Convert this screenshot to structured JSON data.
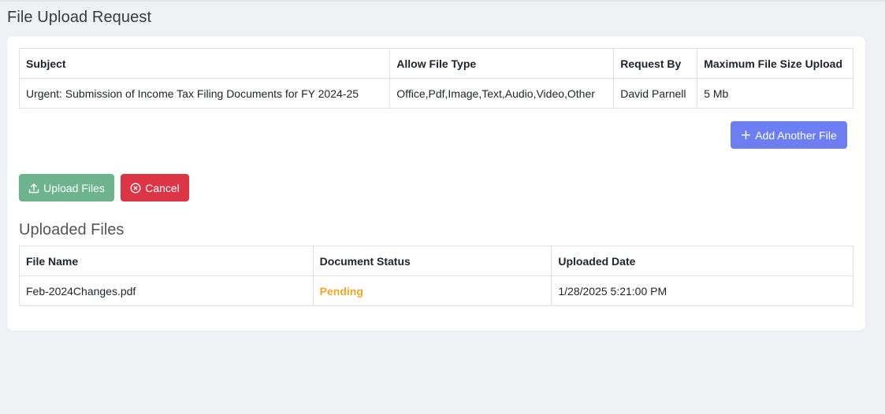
{
  "page": {
    "title": "File Upload Request"
  },
  "request_table": {
    "headers": [
      "Subject",
      "Allow File Type",
      "Request By",
      "Maximum File Size Upload"
    ],
    "row": {
      "subject": "Urgent: Submission of Income Tax Filing Documents for FY 2024-25",
      "allow_file_type": "Office,Pdf,Image,Text,Audio,Video,Other",
      "request_by": "David Parnell",
      "max_size": "5 Mb"
    }
  },
  "buttons": {
    "add_another_file": "Add Another File",
    "upload_files": "Upload Files",
    "cancel": "Cancel"
  },
  "icons": {
    "add": "plus-icon",
    "upload": "upload-icon",
    "cancel": "circle-x-icon"
  },
  "uploaded": {
    "title": "Uploaded Files",
    "headers": [
      "File Name",
      "Document Status",
      "Uploaded Date"
    ],
    "rows": [
      {
        "file_name": "Feb-2024Changes.pdf",
        "status": "Pending",
        "uploaded_date": "1/28/2025 5:21:00 PM"
      }
    ]
  },
  "colors": {
    "add_button": "#6c7ef0",
    "upload_button": "#6cb38e",
    "cancel_button": "#dc3545",
    "pending_status": "#f5a623"
  }
}
